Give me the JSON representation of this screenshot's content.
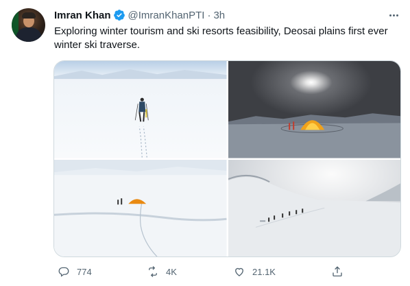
{
  "tweet": {
    "author_name": "Imran Khan",
    "handle": "@ImranKhanPTI",
    "separator": "·",
    "time": "3h",
    "text": "Exploring winter tourism and ski resorts feasibility, Deosai plains first ever winter ski traverse."
  },
  "media": [
    {
      "description_icon": "photo"
    },
    {
      "description_icon": "photo"
    },
    {
      "description_icon": "photo"
    },
    {
      "description_icon": "photo"
    }
  ],
  "actions": {
    "replies": "774",
    "retweets": "4K",
    "likes": "21.1K"
  },
  "colors": {
    "verified": "#1d9bf0",
    "muted": "#536471",
    "text": "#0f1419",
    "border": "#cfd9de"
  }
}
